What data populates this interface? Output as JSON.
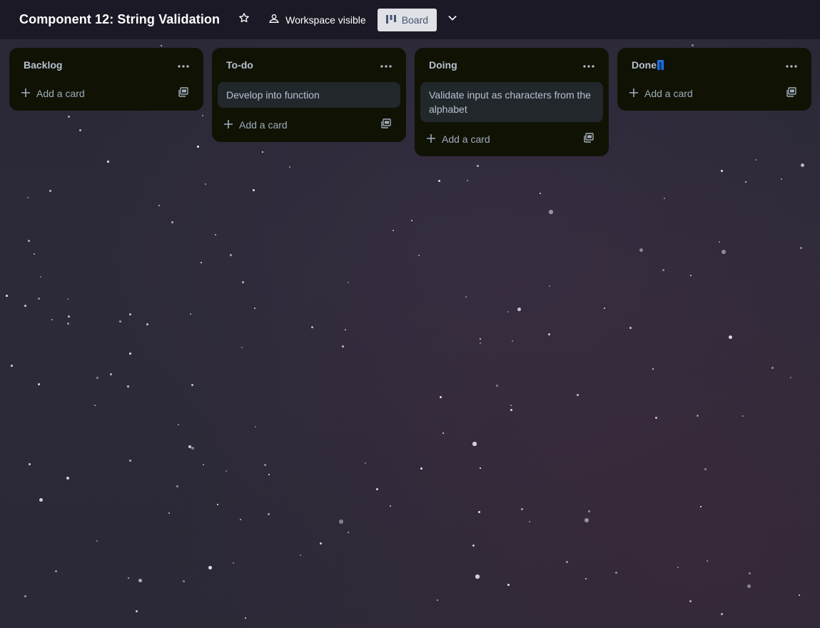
{
  "header": {
    "title": "Component 12: String Validation",
    "visibility_label": "Workspace visible",
    "view_label": "Board",
    "icons": {
      "star": "star-icon",
      "visibility": "people-icon",
      "view": "board-icon",
      "chevron": "chevron-down-icon"
    }
  },
  "lists": [
    {
      "title": "Backlog",
      "cards": [],
      "add_label": "Add a card"
    },
    {
      "title": "To-do",
      "cards": [
        {
          "text": "Develop into function"
        }
      ],
      "add_label": "Add a card"
    },
    {
      "title": "Doing",
      "cards": [
        {
          "text": "Validate input as characters from the alphabet"
        }
      ],
      "add_label": "Add a card"
    },
    {
      "title": "Done",
      "cards": [],
      "add_label": "Add a card"
    }
  ],
  "colors": {
    "list_bg": "#101204",
    "card_bg": "#22272b",
    "text": "#b6c2cf",
    "view_button_bg": "#dfe1e6"
  }
}
